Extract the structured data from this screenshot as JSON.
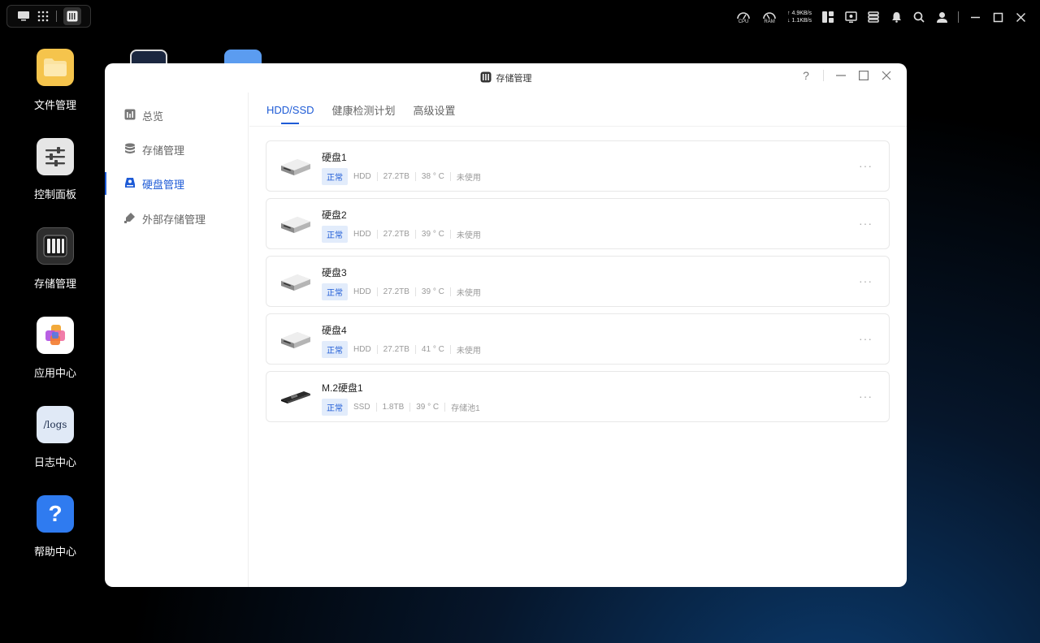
{
  "topbar": {
    "cpu_label": "CPU",
    "ram_label": "RAM",
    "upload": "4.9KB/s",
    "download": "1.1KB/s"
  },
  "desktop": {
    "icons": [
      {
        "label": "文件管理",
        "icon": "folder-icon",
        "color": "#f6c04a"
      },
      {
        "label": "控制面板",
        "icon": "sliders-icon",
        "color": "#e8e8e8"
      },
      {
        "label": "存储管理",
        "icon": "storage-icon",
        "color": "#2b2b2b"
      },
      {
        "label": "应用中心",
        "icon": "apps-icon",
        "color": "#ffffff"
      },
      {
        "label": "日志中心",
        "icon": "logs-icon",
        "color": "#dfe8f5",
        "tile_text": "/logs"
      },
      {
        "label": "帮助中心",
        "icon": "help-icon",
        "color": "#2f7bf0",
        "tile_text": "?"
      }
    ]
  },
  "window": {
    "title": "存储管理",
    "help": "?",
    "sidebar": [
      {
        "label": "总览",
        "icon": "chart-icon"
      },
      {
        "label": "存储管理",
        "icon": "database-icon"
      },
      {
        "label": "硬盘管理",
        "icon": "disk-icon",
        "active": true
      },
      {
        "label": "外部存储管理",
        "icon": "usb-icon"
      }
    ],
    "tabs": [
      {
        "label": "HDD/SSD",
        "active": true
      },
      {
        "label": "健康检测计划"
      },
      {
        "label": "高级设置"
      }
    ],
    "disks": [
      {
        "name": "硬盘1",
        "status": "正常",
        "type": "HDD",
        "size": "27.2TB",
        "temp": "38 ° C",
        "usage": "未使用"
      },
      {
        "name": "硬盘2",
        "status": "正常",
        "type": "HDD",
        "size": "27.2TB",
        "temp": "39 ° C",
        "usage": "未使用"
      },
      {
        "name": "硬盘3",
        "status": "正常",
        "type": "HDD",
        "size": "27.2TB",
        "temp": "39 ° C",
        "usage": "未使用"
      },
      {
        "name": "硬盘4",
        "status": "正常",
        "type": "HDD",
        "size": "27.2TB",
        "temp": "41 ° C",
        "usage": "未使用"
      },
      {
        "name": "M.2硬盘1",
        "status": "正常",
        "type": "SSD",
        "size": "1.8TB",
        "temp": "39 ° C",
        "usage": "存储池1"
      }
    ],
    "more_label": "···"
  },
  "colors": {
    "accent": "#1e5bd6",
    "badge_bg": "#e2ecfb"
  }
}
